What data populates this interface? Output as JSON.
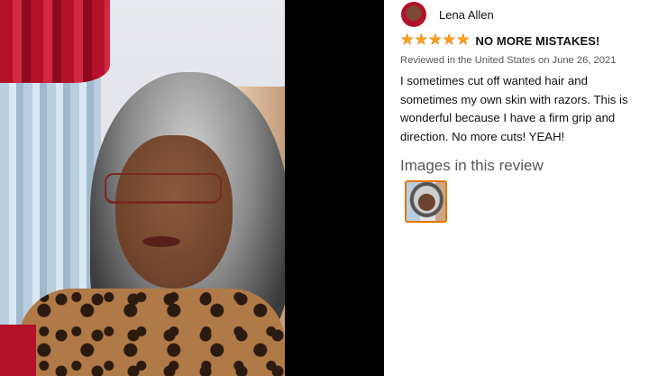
{
  "review": {
    "reviewer_name": "Lena Allen",
    "star_count": 5,
    "stars": [
      "★",
      "★",
      "★",
      "★",
      "★"
    ],
    "headline": "NO MORE MISTAKES!",
    "meta": "Reviewed in the United States on June 26, 2021",
    "body": "I sometimes cut off wanted hair and sometimes my own skin with razors. This is wonderful because I have a firm grip and direction. No more cuts! YEAH!",
    "images_title": "Images in this review"
  },
  "colors": {
    "star": "#ffa41c",
    "thumb_border": "#e77600",
    "text": "#0f1111",
    "muted": "#565959"
  },
  "icons": {
    "star": "star-icon",
    "avatar": "avatar"
  }
}
